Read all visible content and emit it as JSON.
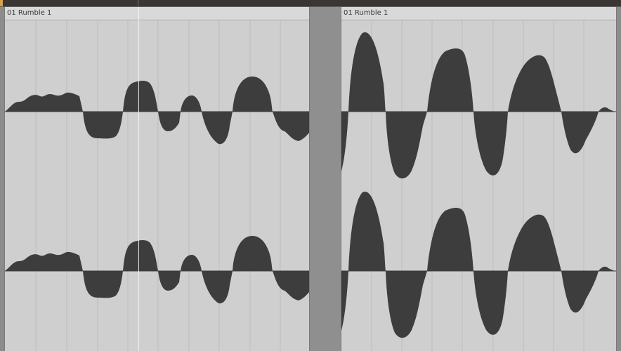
{
  "regions": [
    {
      "name": "01 Rumble 1"
    },
    {
      "name": "01 Rumble 1"
    }
  ],
  "colors": {
    "waveform": "#3d3d3d",
    "region_bg": "#cfcfcf",
    "grid": "#bdbdbd",
    "background": "#8c8c8c",
    "playhead": "#f4f4f4"
  }
}
